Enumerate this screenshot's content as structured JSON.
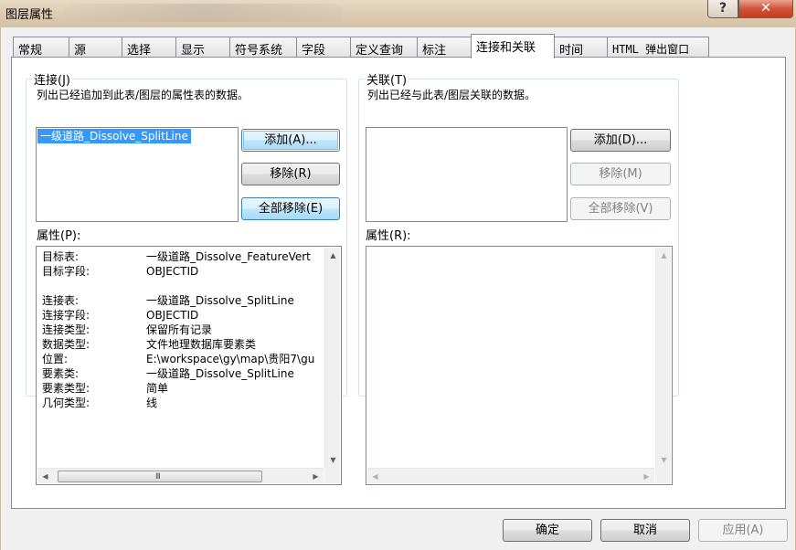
{
  "window": {
    "title": "图层属性",
    "help_label": "?",
    "close_label": "✕"
  },
  "tabs": [
    {
      "label": "常规"
    },
    {
      "label": "源"
    },
    {
      "label": "选择"
    },
    {
      "label": "显示"
    },
    {
      "label": "符号系统"
    },
    {
      "label": "字段"
    },
    {
      "label": "定义查询"
    },
    {
      "label": "标注"
    },
    {
      "label": "连接和关联",
      "active": true
    },
    {
      "label": "时间"
    },
    {
      "label": "HTML 弹出窗口"
    }
  ],
  "joins": {
    "group_label": "连接(J)",
    "description": "列出已经追加到此表/图层的属性表的数据。",
    "items": [
      "一级道路_Dissolve_SplitLine"
    ],
    "add_button": "添加(A)...",
    "remove_button": "移除(R)",
    "remove_all_button": "全部移除(E)",
    "properties_label": "属性(P):",
    "properties": [
      {
        "key": "目标表:",
        "value": "一级道路_Dissolve_FeatureVert"
      },
      {
        "key": "目标字段:",
        "value": "OBJECTID"
      },
      {
        "key": "",
        "value": ""
      },
      {
        "key": "连接表:",
        "value": "一级道路_Dissolve_SplitLine"
      },
      {
        "key": "连接字段:",
        "value": "OBJECTID"
      },
      {
        "key": "连接类型:",
        "value": "保留所有记录"
      },
      {
        "key": "数据类型:",
        "value": "文件地理数据库要素类"
      },
      {
        "key": "位置:",
        "value": "E:\\workspace\\gy\\map\\贵阳7\\gu"
      },
      {
        "key": "要素类:",
        "value": "一级道路_Dissolve_SplitLine"
      },
      {
        "key": "要素类型:",
        "value": "简单"
      },
      {
        "key": "几何类型:",
        "value": "线"
      }
    ]
  },
  "relates": {
    "group_label": "关联(T)",
    "description": "列出已经与此表/图层关联的数据。",
    "add_button": "添加(D)...",
    "remove_button": "移除(M)",
    "remove_all_button": "全部移除(V)",
    "properties_label": "属性(R):"
  },
  "scroll": {
    "up": "▲",
    "down": "▼",
    "left": "◀",
    "right": "▶",
    "grip": "III"
  },
  "footer": {
    "ok": "确定",
    "cancel": "取消",
    "apply": "应用(A)"
  }
}
